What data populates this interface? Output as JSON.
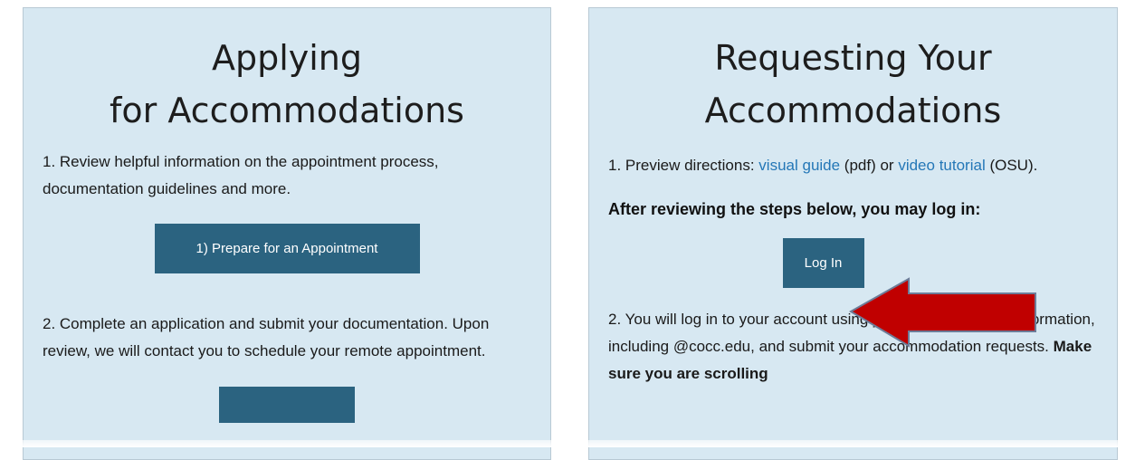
{
  "left_card": {
    "title_line1": "Applying",
    "title_line2": "for Accommodations",
    "step1_text": "1.  Review helpful information on the appointment process, documentation guidelines and more.",
    "button1_label": "1) Prepare for an Appointment",
    "step2_text": "2.  Complete an application and submit your documentation.  Upon review, we will contact you to schedule your remote appointment."
  },
  "right_card": {
    "title_line1": "Requesting Your",
    "title_line2": "Accommodations",
    "step1_prefix": "1.  Preview directions: ",
    "visual_guide_link": "visual guide",
    "pdf_text": " (pdf) or ",
    "video_tutorial_link": "video tutorial",
    "osu_text": " (OSU).",
    "bold_instruction": "After reviewing the steps below, you may log in:",
    "login_label": "Log In",
    "step2_text": "2.  You will log in to your account using your Single Sign-On information, including @cocc.edu, and submit your accommodation requests.",
    "step2_bold": " Make sure you are scrolling"
  },
  "colors": {
    "card_background": "#d7e8f2",
    "button": "#2b6380",
    "link": "#2477b7",
    "arrow": "#c00000"
  },
  "icons": {
    "arrow": "left-pointing-arrow-icon"
  }
}
